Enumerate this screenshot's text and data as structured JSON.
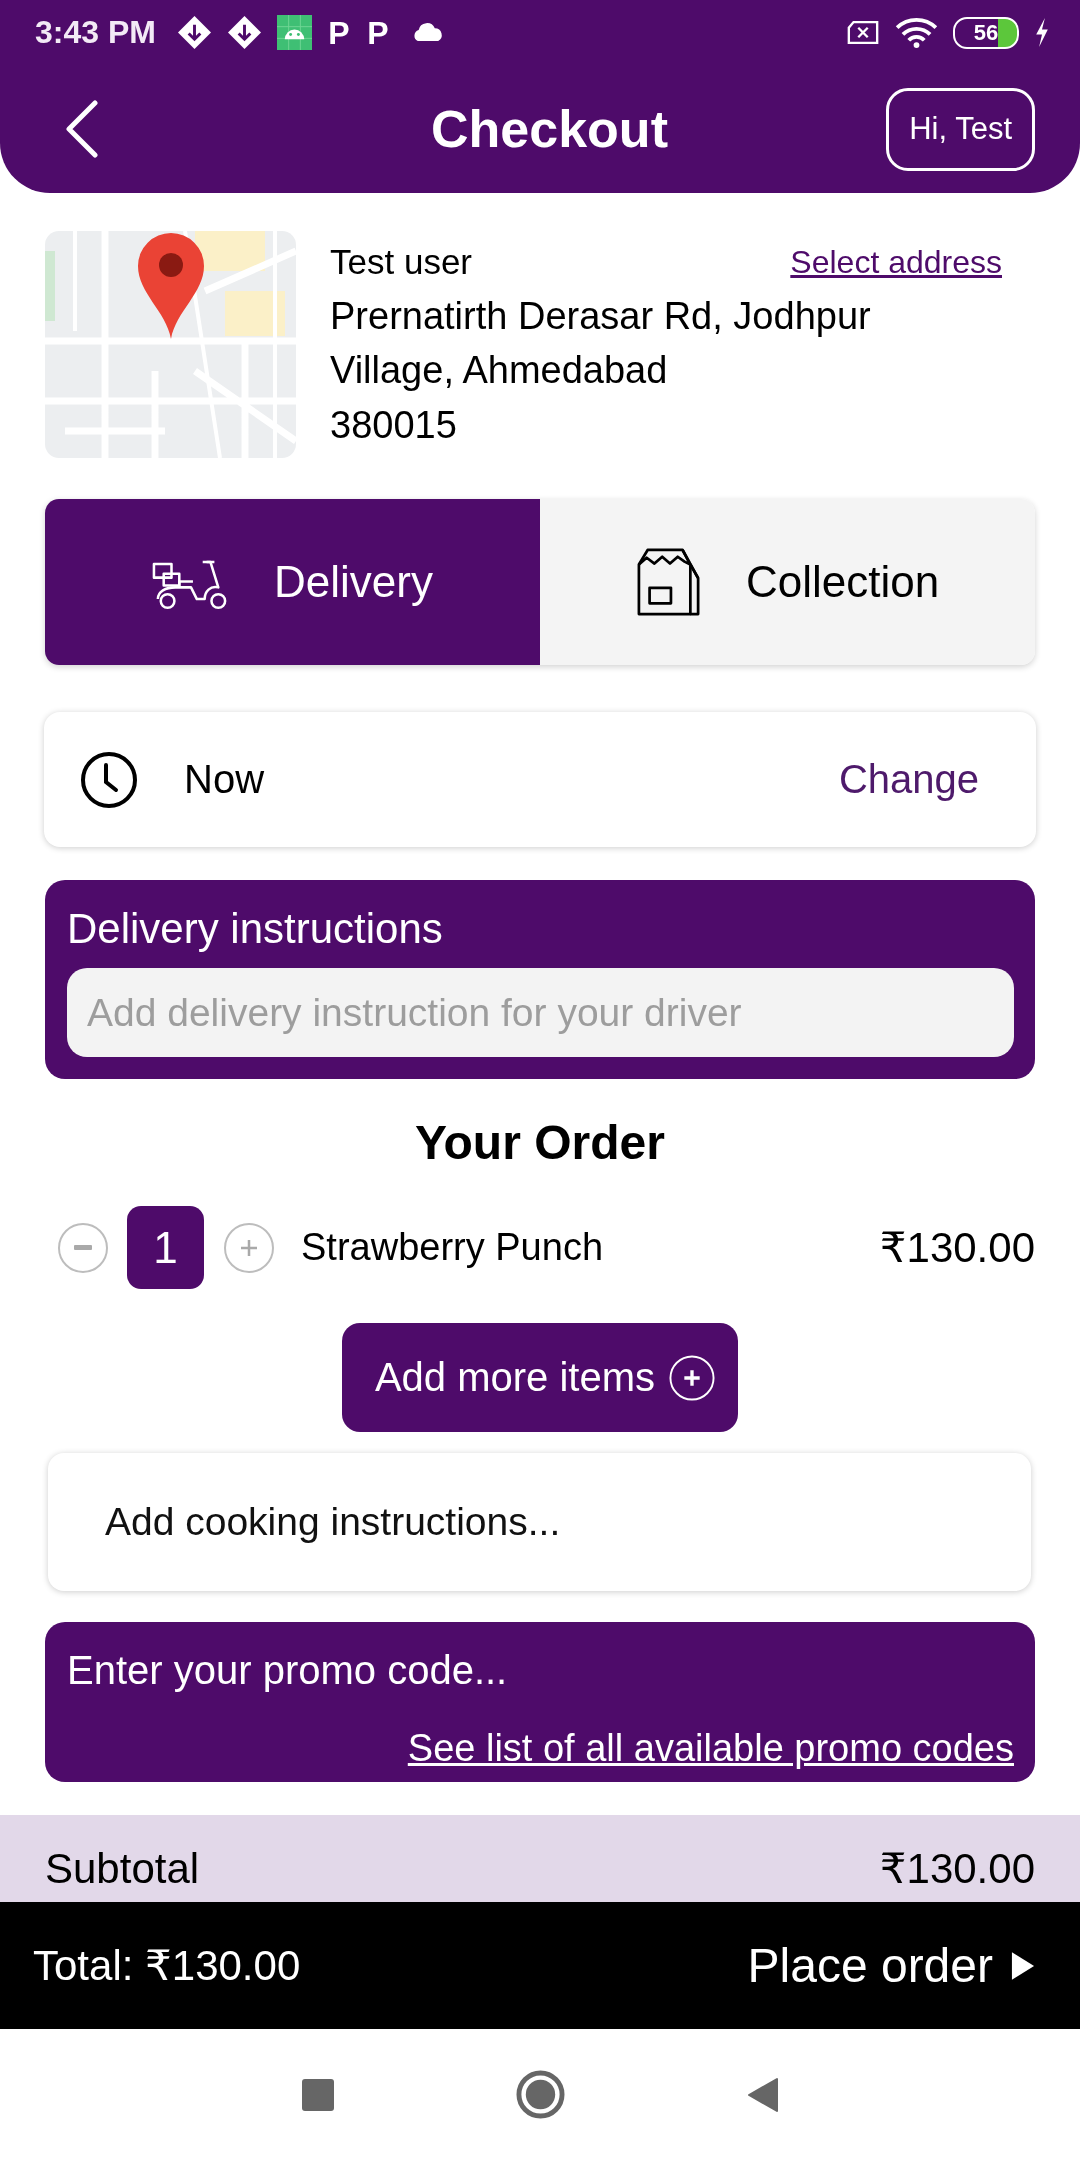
{
  "status_bar": {
    "time": "3:43 PM",
    "app_letters": [
      "P",
      "P"
    ],
    "battery": "56"
  },
  "header": {
    "title": "Checkout",
    "greeting_button": "Hi, Test"
  },
  "address": {
    "name": "Test user",
    "select_link": "Select address",
    "street": "Prernatirth Derasar Rd, Jodhpur Village, Ahmedabad",
    "postcode": "380015"
  },
  "fulfilment_tabs": [
    {
      "kind": "delivery",
      "label": "Delivery",
      "selected": true
    },
    {
      "kind": "collection",
      "label": "Collection",
      "selected": false
    }
  ],
  "time_slot": {
    "label": "Now",
    "action": "Change"
  },
  "delivery_instructions": {
    "title": "Delivery instructions",
    "placeholder": "Add delivery instruction for your driver"
  },
  "order": {
    "title": "Your Order",
    "items": [
      {
        "quantity": "1",
        "name": "Strawberry Punch",
        "price": "₹130.00"
      }
    ],
    "add_more_button": "Add more items"
  },
  "cooking_instructions": {
    "placeholder": "Add cooking instructions..."
  },
  "promo": {
    "placeholder": "Enter your promo code...",
    "link": "See list of all available promo codes"
  },
  "subtotal": {
    "label": "Subtotal",
    "value": "₹130.00"
  },
  "footer": {
    "total": "Total: ₹130.00",
    "button": "Place order"
  }
}
